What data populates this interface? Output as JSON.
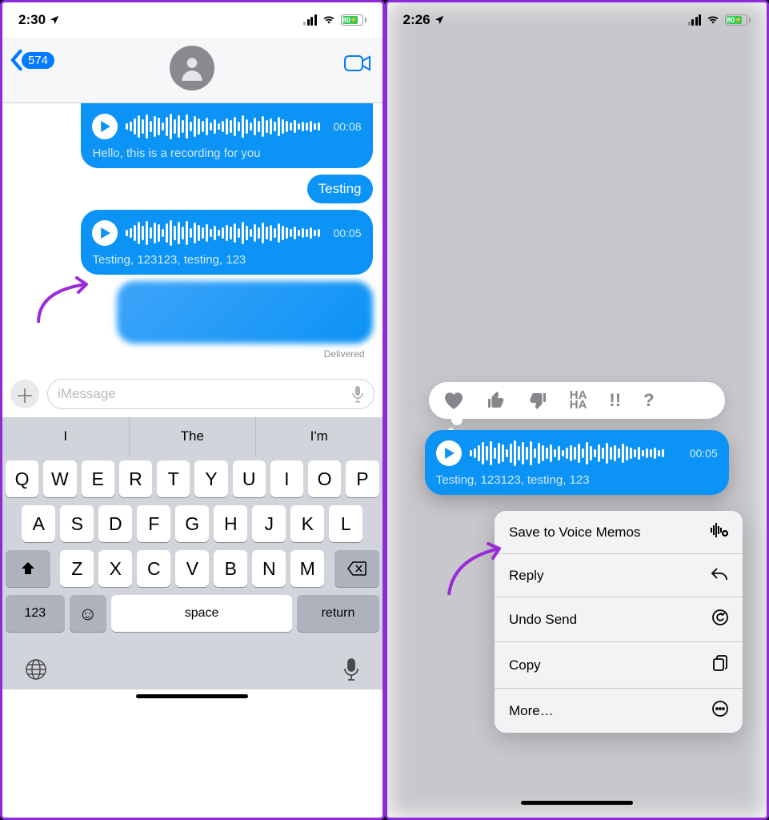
{
  "left": {
    "status_time": "2:30",
    "battery_pct": "80",
    "unread_count": "574",
    "msg1": {
      "duration": "00:08",
      "caption": "Hello, this is a recording for you"
    },
    "msg2": {
      "text": "Testing"
    },
    "msg3": {
      "duration": "00:05",
      "caption": "Testing, 123123, testing, 123"
    },
    "delivered": "Delivered",
    "compose_placeholder": "iMessage",
    "suggestions": [
      "I",
      "The",
      "I'm"
    ],
    "keyboard": {
      "row1": [
        "Q",
        "W",
        "E",
        "R",
        "T",
        "Y",
        "U",
        "I",
        "O",
        "P"
      ],
      "row2": [
        "A",
        "S",
        "D",
        "F",
        "G",
        "H",
        "J",
        "K",
        "L"
      ],
      "row3": [
        "Z",
        "X",
        "C",
        "V",
        "B",
        "N",
        "M"
      ],
      "num_key": "123",
      "space": "space",
      "return": "return"
    }
  },
  "right": {
    "status_time": "2:26",
    "battery_pct": "80",
    "tapbacks": {
      "haha": "HA\nHA",
      "exclaim": "!!",
      "question": "?"
    },
    "selected_msg": {
      "duration": "00:05",
      "caption": "Testing, 123123, testing, 123"
    },
    "menu": {
      "save": "Save to Voice Memos",
      "reply": "Reply",
      "undo": "Undo Send",
      "copy": "Copy",
      "more": "More…"
    }
  }
}
